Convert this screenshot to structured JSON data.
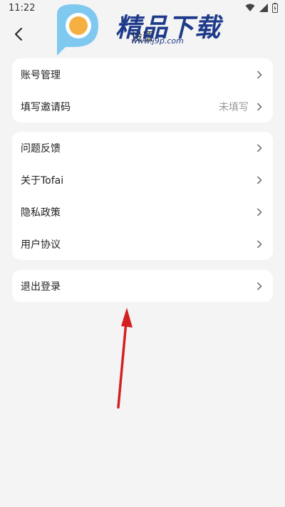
{
  "status_bar": {
    "time": "11:22"
  },
  "nav": {
    "title": "设置"
  },
  "watermark": {
    "brand": "精品下载",
    "url": "www.j9p.com"
  },
  "groups": [
    {
      "items": [
        {
          "label": "账号管理",
          "value": ""
        },
        {
          "label": "填写邀请码",
          "value": "未填写"
        }
      ]
    },
    {
      "items": [
        {
          "label": "问题反馈",
          "value": ""
        },
        {
          "label": "关于Tofai",
          "value": ""
        },
        {
          "label": "隐私政策",
          "value": ""
        },
        {
          "label": "用户协议",
          "value": ""
        }
      ]
    },
    {
      "items": [
        {
          "label": "退出登录",
          "value": ""
        }
      ]
    }
  ],
  "colors": {
    "background": "#f4f4f4",
    "card": "#ffffff",
    "annotation_arrow": "#d42020"
  }
}
